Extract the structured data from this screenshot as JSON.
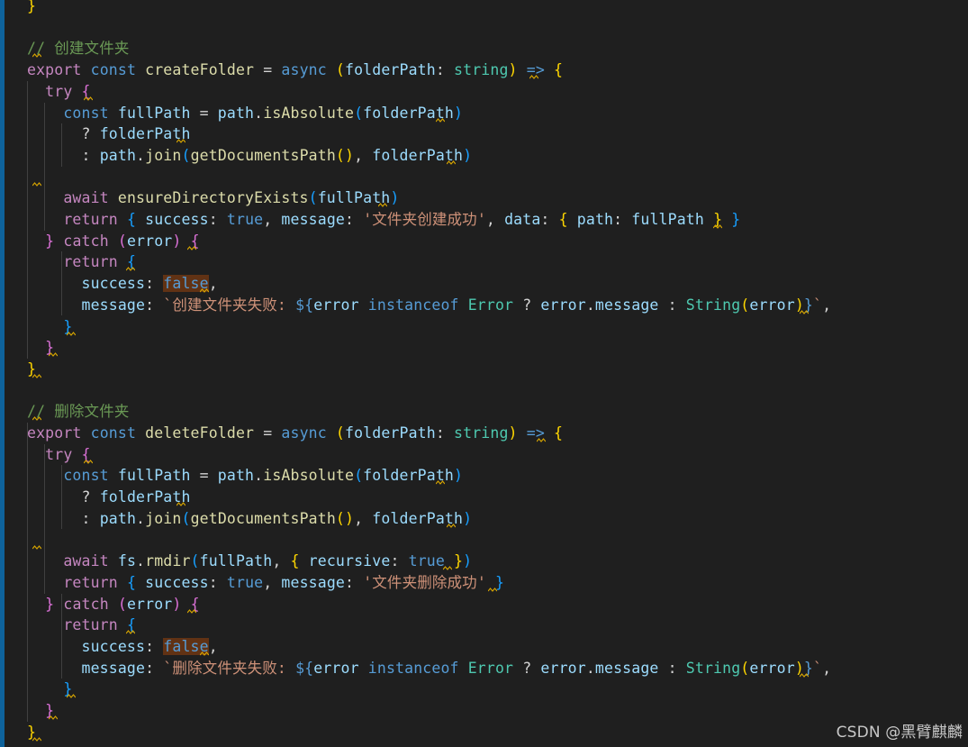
{
  "editor": {
    "theme_colors": {
      "background": "#1f1f1f",
      "keyword": "#569cd6",
      "control": "#c586c0",
      "variable": "#9cdcfe",
      "function": "#dcdcaa",
      "type": "#4ec9b0",
      "string": "#ce9178",
      "comment": "#6a9955",
      "bracket_level1": "#ffd700",
      "bracket_level2": "#da70d6",
      "bracket_level3": "#179fff",
      "warning_squiggle": "#d7a500"
    },
    "lines": [
      [
        [
          "}",
          "b1"
        ]
      ],
      [],
      [
        [
          "// 创建文件夹",
          "cmt"
        ]
      ],
      [
        [
          "export",
          "ctrl"
        ],
        [
          " ",
          "punc"
        ],
        [
          "const",
          "kw"
        ],
        [
          " ",
          "punc"
        ],
        [
          "createFolder",
          "fn"
        ],
        [
          " = ",
          "punc"
        ],
        [
          "async",
          "kw"
        ],
        [
          " ",
          "punc"
        ],
        [
          "(",
          "b1"
        ],
        [
          "folderPath",
          "var"
        ],
        [
          ": ",
          "punc"
        ],
        [
          "string",
          "type"
        ],
        [
          ")",
          "b1"
        ],
        [
          " ",
          "punc"
        ],
        [
          "=>",
          "kw"
        ],
        [
          " ",
          "punc"
        ],
        [
          "{",
          "b1"
        ]
      ],
      [
        [
          "  ",
          "punc"
        ],
        [
          "try",
          "ctrl"
        ],
        [
          " ",
          "punc"
        ],
        [
          "{",
          "b2"
        ]
      ],
      [
        [
          "    ",
          "punc"
        ],
        [
          "const",
          "kw"
        ],
        [
          " ",
          "punc"
        ],
        [
          "fullPath",
          "var"
        ],
        [
          " = ",
          "punc"
        ],
        [
          "path",
          "var"
        ],
        [
          ".",
          "punc"
        ],
        [
          "isAbsolute",
          "fn"
        ],
        [
          "(",
          "b3"
        ],
        [
          "folderPath",
          "var"
        ],
        [
          ")",
          "b3"
        ]
      ],
      [
        [
          "      ",
          "punc"
        ],
        [
          "? ",
          "punc"
        ],
        [
          "folderPath",
          "var"
        ]
      ],
      [
        [
          "      ",
          "punc"
        ],
        [
          ": ",
          "punc"
        ],
        [
          "path",
          "var"
        ],
        [
          ".",
          "punc"
        ],
        [
          "join",
          "fn"
        ],
        [
          "(",
          "b3"
        ],
        [
          "getDocumentsPath",
          "fn"
        ],
        [
          "(",
          "b1"
        ],
        [
          ")",
          "b1"
        ],
        [
          ", ",
          "punc"
        ],
        [
          "folderPath",
          "var"
        ],
        [
          ")",
          "b3"
        ]
      ],
      [],
      [
        [
          "    ",
          "punc"
        ],
        [
          "await",
          "ctrl"
        ],
        [
          " ",
          "punc"
        ],
        [
          "ensureDirectoryExists",
          "fn"
        ],
        [
          "(",
          "b3"
        ],
        [
          "fullPath",
          "var"
        ],
        [
          ")",
          "b3"
        ]
      ],
      [
        [
          "    ",
          "punc"
        ],
        [
          "return",
          "ctrl"
        ],
        [
          " ",
          "punc"
        ],
        [
          "{",
          "b3"
        ],
        [
          " ",
          "punc"
        ],
        [
          "success",
          "var"
        ],
        [
          ": ",
          "punc"
        ],
        [
          "true",
          "kw"
        ],
        [
          ", ",
          "punc"
        ],
        [
          "message",
          "var"
        ],
        [
          ": ",
          "punc"
        ],
        [
          "'文件夹创建成功'",
          "str"
        ],
        [
          ", ",
          "punc"
        ],
        [
          "data",
          "var"
        ],
        [
          ": ",
          "punc"
        ],
        [
          "{",
          "b1"
        ],
        [
          " ",
          "punc"
        ],
        [
          "path",
          "var"
        ],
        [
          ": ",
          "punc"
        ],
        [
          "fullPath",
          "var"
        ],
        [
          " ",
          "punc"
        ],
        [
          "}",
          "b1"
        ],
        [
          " ",
          "punc"
        ],
        [
          "}",
          "b3"
        ]
      ],
      [
        [
          "  ",
          "punc"
        ],
        [
          "}",
          "b2"
        ],
        [
          " ",
          "punc"
        ],
        [
          "catch",
          "ctrl"
        ],
        [
          " ",
          "punc"
        ],
        [
          "(",
          "b2"
        ],
        [
          "error",
          "var"
        ],
        [
          ")",
          "b2"
        ],
        [
          " ",
          "punc"
        ],
        [
          "{",
          "b2"
        ]
      ],
      [
        [
          "    ",
          "punc"
        ],
        [
          "return",
          "ctrl"
        ],
        [
          " ",
          "punc"
        ],
        [
          "{",
          "b3"
        ]
      ],
      [
        [
          "      ",
          "punc"
        ],
        [
          "success",
          "var"
        ],
        [
          ": ",
          "punc"
        ],
        [
          "false",
          "kw hl"
        ],
        [
          ",",
          "punc"
        ]
      ],
      [
        [
          "      ",
          "punc"
        ],
        [
          "message",
          "var"
        ],
        [
          ": ",
          "punc"
        ],
        [
          "`创建文件夹失败: ",
          "str"
        ],
        [
          "${",
          "kw"
        ],
        [
          "error",
          "var"
        ],
        [
          " ",
          "punc"
        ],
        [
          "instanceof",
          "kw"
        ],
        [
          " ",
          "punc"
        ],
        [
          "Error",
          "type"
        ],
        [
          " ? ",
          "punc"
        ],
        [
          "error",
          "var"
        ],
        [
          ".",
          "punc"
        ],
        [
          "message",
          "var"
        ],
        [
          " : ",
          "punc"
        ],
        [
          "String",
          "type"
        ],
        [
          "(",
          "b1"
        ],
        [
          "error",
          "var"
        ],
        [
          ")",
          "b1"
        ],
        [
          "}",
          "kw"
        ],
        [
          "`",
          "str"
        ],
        [
          ",",
          "punc"
        ]
      ],
      [
        [
          "    ",
          "punc"
        ],
        [
          "}",
          "b3"
        ]
      ],
      [
        [
          "  ",
          "punc"
        ],
        [
          "}",
          "b2"
        ]
      ],
      [
        [
          "}",
          "b1"
        ]
      ],
      [],
      [
        [
          "// 删除文件夹",
          "cmt"
        ]
      ],
      [
        [
          "export",
          "ctrl"
        ],
        [
          " ",
          "punc"
        ],
        [
          "const",
          "kw"
        ],
        [
          " ",
          "punc"
        ],
        [
          "deleteFolder",
          "fn"
        ],
        [
          " = ",
          "punc"
        ],
        [
          "async",
          "kw"
        ],
        [
          " ",
          "punc"
        ],
        [
          "(",
          "b1"
        ],
        [
          "folderPath",
          "var"
        ],
        [
          ": ",
          "punc"
        ],
        [
          "string",
          "type"
        ],
        [
          ")",
          "b1"
        ],
        [
          " ",
          "punc"
        ],
        [
          "=>",
          "kw"
        ],
        [
          " ",
          "punc"
        ],
        [
          "{",
          "b1"
        ]
      ],
      [
        [
          "  ",
          "punc"
        ],
        [
          "try",
          "ctrl"
        ],
        [
          " ",
          "punc"
        ],
        [
          "{",
          "b2"
        ]
      ],
      [
        [
          "    ",
          "punc"
        ],
        [
          "const",
          "kw"
        ],
        [
          " ",
          "punc"
        ],
        [
          "fullPath",
          "var"
        ],
        [
          " = ",
          "punc"
        ],
        [
          "path",
          "var"
        ],
        [
          ".",
          "punc"
        ],
        [
          "isAbsolute",
          "fn"
        ],
        [
          "(",
          "b3"
        ],
        [
          "folderPath",
          "var"
        ],
        [
          ")",
          "b3"
        ]
      ],
      [
        [
          "      ",
          "punc"
        ],
        [
          "? ",
          "punc"
        ],
        [
          "folderPath",
          "var"
        ]
      ],
      [
        [
          "      ",
          "punc"
        ],
        [
          ": ",
          "punc"
        ],
        [
          "path",
          "var"
        ],
        [
          ".",
          "punc"
        ],
        [
          "join",
          "fn"
        ],
        [
          "(",
          "b3"
        ],
        [
          "getDocumentsPath",
          "fn"
        ],
        [
          "(",
          "b1"
        ],
        [
          ")",
          "b1"
        ],
        [
          ", ",
          "punc"
        ],
        [
          "folderPath",
          "var"
        ],
        [
          ")",
          "b3"
        ]
      ],
      [],
      [
        [
          "    ",
          "punc"
        ],
        [
          "await",
          "ctrl"
        ],
        [
          " ",
          "punc"
        ],
        [
          "fs",
          "var"
        ],
        [
          ".",
          "punc"
        ],
        [
          "rmdir",
          "fn"
        ],
        [
          "(",
          "b3"
        ],
        [
          "fullPath",
          "var"
        ],
        [
          ", ",
          "punc"
        ],
        [
          "{",
          "b1"
        ],
        [
          " ",
          "punc"
        ],
        [
          "recursive",
          "var"
        ],
        [
          ": ",
          "punc"
        ],
        [
          "true",
          "kw"
        ],
        [
          " ",
          "punc"
        ],
        [
          "}",
          "b1"
        ],
        [
          ")",
          "b3"
        ]
      ],
      [
        [
          "    ",
          "punc"
        ],
        [
          "return",
          "ctrl"
        ],
        [
          " ",
          "punc"
        ],
        [
          "{",
          "b3"
        ],
        [
          " ",
          "punc"
        ],
        [
          "success",
          "var"
        ],
        [
          ": ",
          "punc"
        ],
        [
          "true",
          "kw"
        ],
        [
          ", ",
          "punc"
        ],
        [
          "message",
          "var"
        ],
        [
          ": ",
          "punc"
        ],
        [
          "'文件夹删除成功'",
          "str"
        ],
        [
          " ",
          "punc"
        ],
        [
          "}",
          "b3"
        ]
      ],
      [
        [
          "  ",
          "punc"
        ],
        [
          "}",
          "b2"
        ],
        [
          " ",
          "punc"
        ],
        [
          "catch",
          "ctrl"
        ],
        [
          " ",
          "punc"
        ],
        [
          "(",
          "b2"
        ],
        [
          "error",
          "var"
        ],
        [
          ")",
          "b2"
        ],
        [
          " ",
          "punc"
        ],
        [
          "{",
          "b2"
        ]
      ],
      [
        [
          "    ",
          "punc"
        ],
        [
          "return",
          "ctrl"
        ],
        [
          " ",
          "punc"
        ],
        [
          "{",
          "b3"
        ]
      ],
      [
        [
          "      ",
          "punc"
        ],
        [
          "success",
          "var"
        ],
        [
          ": ",
          "punc"
        ],
        [
          "false",
          "kw hl"
        ],
        [
          ",",
          "punc"
        ]
      ],
      [
        [
          "      ",
          "punc"
        ],
        [
          "message",
          "var"
        ],
        [
          ": ",
          "punc"
        ],
        [
          "`删除文件夹失败: ",
          "str"
        ],
        [
          "${",
          "kw"
        ],
        [
          "error",
          "var"
        ],
        [
          " ",
          "punc"
        ],
        [
          "instanceof",
          "kw"
        ],
        [
          " ",
          "punc"
        ],
        [
          "Error",
          "type"
        ],
        [
          " ? ",
          "punc"
        ],
        [
          "error",
          "var"
        ],
        [
          ".",
          "punc"
        ],
        [
          "message",
          "var"
        ],
        [
          " : ",
          "punc"
        ],
        [
          "String",
          "type"
        ],
        [
          "(",
          "b1"
        ],
        [
          "error",
          "var"
        ],
        [
          ")",
          "b1"
        ],
        [
          "}",
          "kw"
        ],
        [
          "`",
          "str"
        ],
        [
          ",",
          "punc"
        ]
      ],
      [
        [
          "    ",
          "punc"
        ],
        [
          "}",
          "b3"
        ]
      ],
      [
        [
          "  ",
          "punc"
        ],
        [
          "}",
          "b2"
        ]
      ],
      [
        [
          "}",
          "b1"
        ]
      ]
    ],
    "squiggle_icon": "warning-squiggle"
  },
  "watermark": {
    "text": "CSDN @黑臂麒麟"
  }
}
